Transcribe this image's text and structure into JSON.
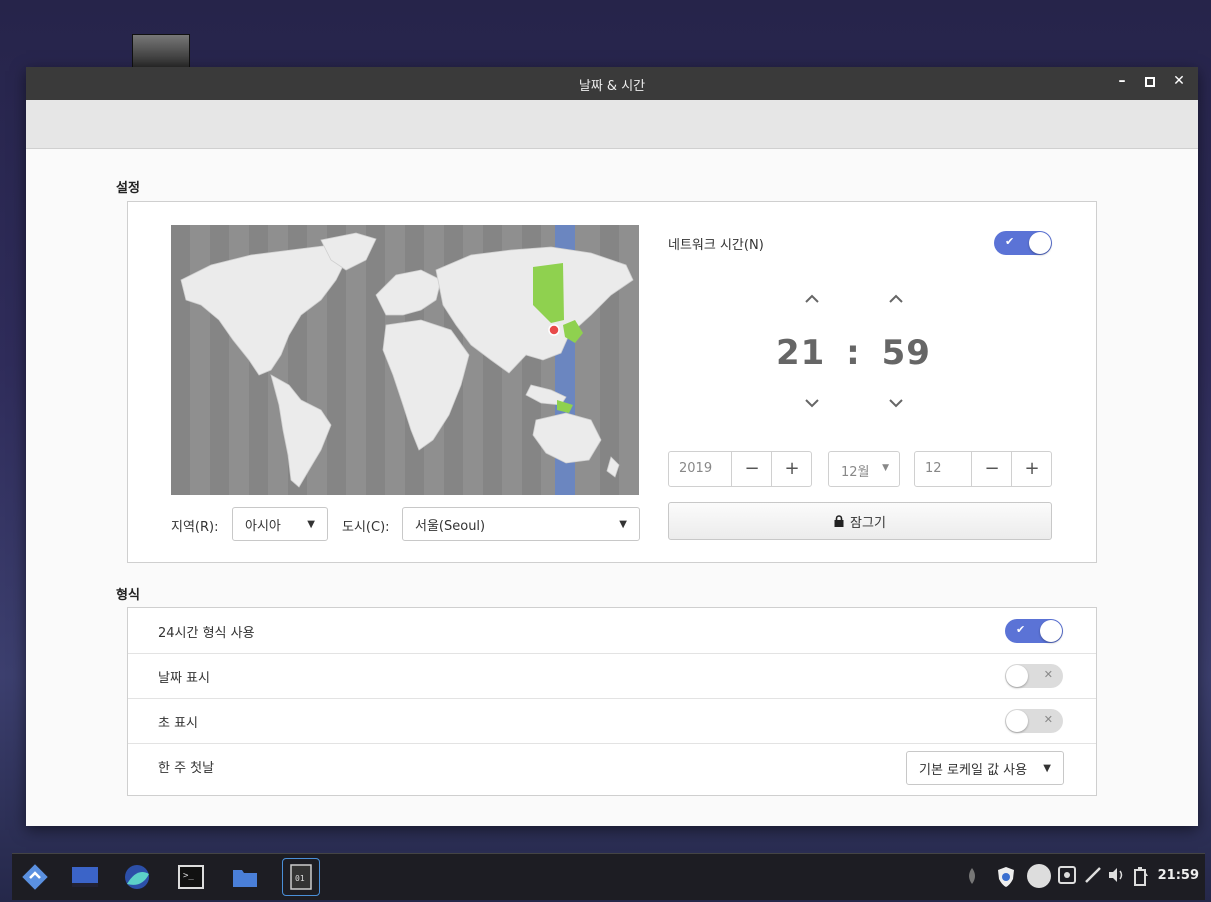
{
  "window": {
    "title": "날짜 & 시간",
    "minimize": "–",
    "maximize": "▫",
    "close": "✕"
  },
  "settings": {
    "section_title": "설정",
    "region_label": "지역(R):",
    "region_value": "아시아",
    "city_label": "도시(C):",
    "city_value": "서울(Seoul)",
    "network_time_label": "네트워크 시간(N)",
    "network_time_on": true,
    "hour": "21",
    "separator": ":",
    "minute": "59",
    "year": "2019",
    "month": "12월",
    "day": "12",
    "minus": "−",
    "plus": "+",
    "lock_label": "잠그기"
  },
  "format": {
    "section_title": "형식",
    "rows": [
      {
        "label": "24시간 형식 사용",
        "on": true
      },
      {
        "label": "날짜 표시",
        "on": false
      },
      {
        "label": "초 표시",
        "on": false
      },
      {
        "label": "한 주 첫날",
        "value": "기본 로케일 값 사용"
      }
    ]
  },
  "taskbar": {
    "clock": "21:59",
    "apps": [
      "launcher-icon",
      "desktop-icon",
      "browser-icon",
      "terminal-icon",
      "files-icon",
      "datetime-app-icon"
    ],
    "tray": [
      "power-icon",
      "shield-icon",
      "circle-icon",
      "screenshot-icon",
      "pen-icon",
      "volume-icon",
      "battery-icon"
    ]
  },
  "colors": {
    "accent": "#5b73d6",
    "selected_zone": "#6b86c0",
    "highlight_land": "#8fd14f"
  }
}
